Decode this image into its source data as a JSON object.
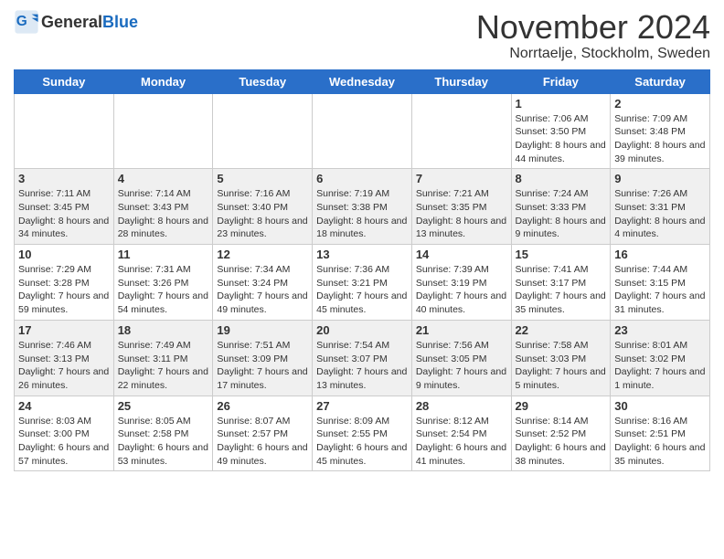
{
  "header": {
    "logo_general": "General",
    "logo_blue": "Blue",
    "month_title": "November 2024",
    "location": "Norrtaelje, Stockholm, Sweden"
  },
  "weekdays": [
    "Sunday",
    "Monday",
    "Tuesday",
    "Wednesday",
    "Thursday",
    "Friday",
    "Saturday"
  ],
  "rows": [
    [
      {
        "day": "",
        "info": ""
      },
      {
        "day": "",
        "info": ""
      },
      {
        "day": "",
        "info": ""
      },
      {
        "day": "",
        "info": ""
      },
      {
        "day": "",
        "info": ""
      },
      {
        "day": "1",
        "info": "Sunrise: 7:06 AM\nSunset: 3:50 PM\nDaylight: 8 hours and 44 minutes."
      },
      {
        "day": "2",
        "info": "Sunrise: 7:09 AM\nSunset: 3:48 PM\nDaylight: 8 hours and 39 minutes."
      }
    ],
    [
      {
        "day": "3",
        "info": "Sunrise: 7:11 AM\nSunset: 3:45 PM\nDaylight: 8 hours and 34 minutes."
      },
      {
        "day": "4",
        "info": "Sunrise: 7:14 AM\nSunset: 3:43 PM\nDaylight: 8 hours and 28 minutes."
      },
      {
        "day": "5",
        "info": "Sunrise: 7:16 AM\nSunset: 3:40 PM\nDaylight: 8 hours and 23 minutes."
      },
      {
        "day": "6",
        "info": "Sunrise: 7:19 AM\nSunset: 3:38 PM\nDaylight: 8 hours and 18 minutes."
      },
      {
        "day": "7",
        "info": "Sunrise: 7:21 AM\nSunset: 3:35 PM\nDaylight: 8 hours and 13 minutes."
      },
      {
        "day": "8",
        "info": "Sunrise: 7:24 AM\nSunset: 3:33 PM\nDaylight: 8 hours and 9 minutes."
      },
      {
        "day": "9",
        "info": "Sunrise: 7:26 AM\nSunset: 3:31 PM\nDaylight: 8 hours and 4 minutes."
      }
    ],
    [
      {
        "day": "10",
        "info": "Sunrise: 7:29 AM\nSunset: 3:28 PM\nDaylight: 7 hours and 59 minutes."
      },
      {
        "day": "11",
        "info": "Sunrise: 7:31 AM\nSunset: 3:26 PM\nDaylight: 7 hours and 54 minutes."
      },
      {
        "day": "12",
        "info": "Sunrise: 7:34 AM\nSunset: 3:24 PM\nDaylight: 7 hours and 49 minutes."
      },
      {
        "day": "13",
        "info": "Sunrise: 7:36 AM\nSunset: 3:21 PM\nDaylight: 7 hours and 45 minutes."
      },
      {
        "day": "14",
        "info": "Sunrise: 7:39 AM\nSunset: 3:19 PM\nDaylight: 7 hours and 40 minutes."
      },
      {
        "day": "15",
        "info": "Sunrise: 7:41 AM\nSunset: 3:17 PM\nDaylight: 7 hours and 35 minutes."
      },
      {
        "day": "16",
        "info": "Sunrise: 7:44 AM\nSunset: 3:15 PM\nDaylight: 7 hours and 31 minutes."
      }
    ],
    [
      {
        "day": "17",
        "info": "Sunrise: 7:46 AM\nSunset: 3:13 PM\nDaylight: 7 hours and 26 minutes."
      },
      {
        "day": "18",
        "info": "Sunrise: 7:49 AM\nSunset: 3:11 PM\nDaylight: 7 hours and 22 minutes."
      },
      {
        "day": "19",
        "info": "Sunrise: 7:51 AM\nSunset: 3:09 PM\nDaylight: 7 hours and 17 minutes."
      },
      {
        "day": "20",
        "info": "Sunrise: 7:54 AM\nSunset: 3:07 PM\nDaylight: 7 hours and 13 minutes."
      },
      {
        "day": "21",
        "info": "Sunrise: 7:56 AM\nSunset: 3:05 PM\nDaylight: 7 hours and 9 minutes."
      },
      {
        "day": "22",
        "info": "Sunrise: 7:58 AM\nSunset: 3:03 PM\nDaylight: 7 hours and 5 minutes."
      },
      {
        "day": "23",
        "info": "Sunrise: 8:01 AM\nSunset: 3:02 PM\nDaylight: 7 hours and 1 minute."
      }
    ],
    [
      {
        "day": "24",
        "info": "Sunrise: 8:03 AM\nSunset: 3:00 PM\nDaylight: 6 hours and 57 minutes."
      },
      {
        "day": "25",
        "info": "Sunrise: 8:05 AM\nSunset: 2:58 PM\nDaylight: 6 hours and 53 minutes."
      },
      {
        "day": "26",
        "info": "Sunrise: 8:07 AM\nSunset: 2:57 PM\nDaylight: 6 hours and 49 minutes."
      },
      {
        "day": "27",
        "info": "Sunrise: 8:09 AM\nSunset: 2:55 PM\nDaylight: 6 hours and 45 minutes."
      },
      {
        "day": "28",
        "info": "Sunrise: 8:12 AM\nSunset: 2:54 PM\nDaylight: 6 hours and 41 minutes."
      },
      {
        "day": "29",
        "info": "Sunrise: 8:14 AM\nSunset: 2:52 PM\nDaylight: 6 hours and 38 minutes."
      },
      {
        "day": "30",
        "info": "Sunrise: 8:16 AM\nSunset: 2:51 PM\nDaylight: 6 hours and 35 minutes."
      }
    ]
  ]
}
